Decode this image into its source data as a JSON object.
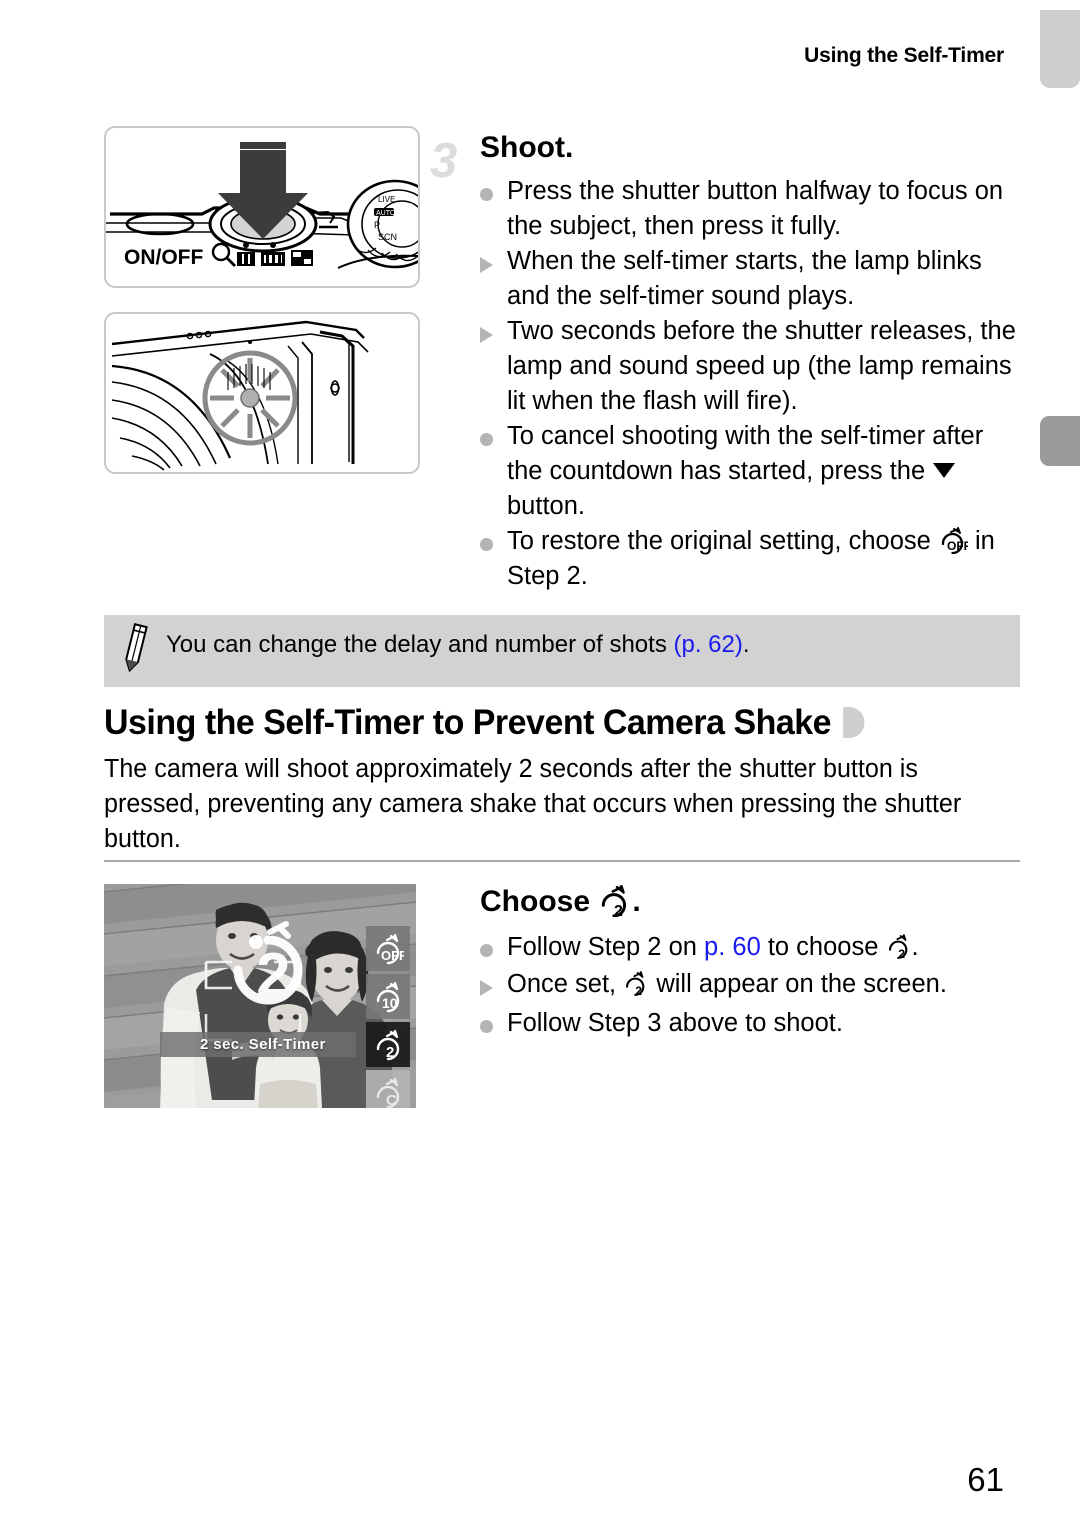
{
  "page": {
    "running_header": "Using the Self-Timer",
    "page_number": "61"
  },
  "step3": {
    "number": "3",
    "title": "Shoot.",
    "bullets": [
      {
        "marker": "dot",
        "text": "Press the shutter button halfway to focus on the subject, then press it fully."
      },
      {
        "marker": "triangle",
        "text": "When the self-timer starts, the lamp blinks and the self-timer sound plays."
      },
      {
        "marker": "triangle",
        "text": "Two seconds before the shutter releases, the lamp and sound speed up (the lamp remains lit when the flash will fire)."
      },
      {
        "marker": "dot",
        "text_before": "To cancel shooting with the self-timer after the countdown has started, press the ",
        "icon": "down-button-icon",
        "text_after": " button."
      },
      {
        "marker": "dot",
        "text_before": "To restore the original setting, choose ",
        "icon": "self-timer-off-icon",
        "text_after": " in Step 2."
      }
    ]
  },
  "note": {
    "icon": "pencil-icon",
    "text_before": "You can change the delay and number of shots ",
    "xref": "(p. 62)",
    "text_after": "."
  },
  "section": {
    "heading": "Using the Self-Timer to Prevent Camera Shake",
    "body": "The camera will shoot approximately 2 seconds after the shutter button is pressed, preventing any camera shake that occurs when pressing the shutter button."
  },
  "choose_step": {
    "title_before": "Choose ",
    "title_icon": "self-timer-2sec-icon",
    "title_after": ".",
    "bullets": [
      {
        "marker": "dot",
        "text_before": "Follow Step 2 on ",
        "xref": "p. 60",
        "text_mid": " to choose ",
        "icon": "self-timer-2sec-icon",
        "text_after": "."
      },
      {
        "marker": "triangle",
        "text_before": "Once set, ",
        "icon": "self-timer-2sec-icon",
        "text_after": " will appear on the screen."
      },
      {
        "marker": "dot",
        "text": "Follow Step 3 above to shoot."
      }
    ]
  },
  "figures": {
    "camera_top": {
      "name": "camera-top-illustration",
      "onoff_label": "ON/OFF",
      "icons": [
        "magnifier-icon",
        "zoom-tele-icon",
        "zoom-wide-icon",
        "index-view-icon"
      ]
    },
    "camera_front": {
      "name": "camera-front-lamp-illustration"
    },
    "lcd_screen": {
      "name": "lcd-self-timer-screen",
      "overlay_digit": "2",
      "caption": "2 sec. Self-Timer",
      "menu_items": [
        {
          "label": "OFF",
          "icon": "self-timer-off-icon",
          "selected": false
        },
        {
          "label": "10",
          "icon": "self-timer-10sec-icon",
          "selected": false
        },
        {
          "label": "2",
          "icon": "self-timer-2sec-icon",
          "selected": true
        },
        {
          "label": "C",
          "icon": "self-timer-custom-icon",
          "selected": false
        }
      ]
    }
  },
  "colors": {
    "note_bg": "#d2d2d2",
    "xref_blue": "#1a1af0",
    "bullet_gray": "#b4b4b4",
    "step_number_gray": "#dcdcdc",
    "tab_light": "#cfcfcf",
    "tab_dark": "#9a9a9a"
  }
}
